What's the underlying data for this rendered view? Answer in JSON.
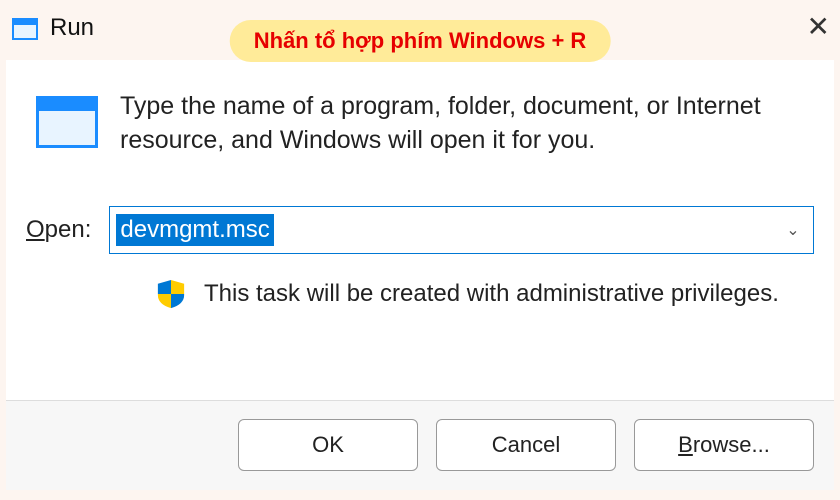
{
  "titlebar": {
    "title": "Run"
  },
  "annotation": "Nhấn tổ hợp phím Windows + R",
  "description": "Type the name of a program, folder, document, or Internet resource, and Windows will open it for you.",
  "open": {
    "label_underlined": "O",
    "label_rest": "pen:",
    "value": "devmgmt.msc"
  },
  "admin_note": "This task will be created with administrative privileges.",
  "buttons": {
    "ok": "OK",
    "cancel": "Cancel",
    "browse_underlined": "B",
    "browse_rest": "rowse..."
  }
}
